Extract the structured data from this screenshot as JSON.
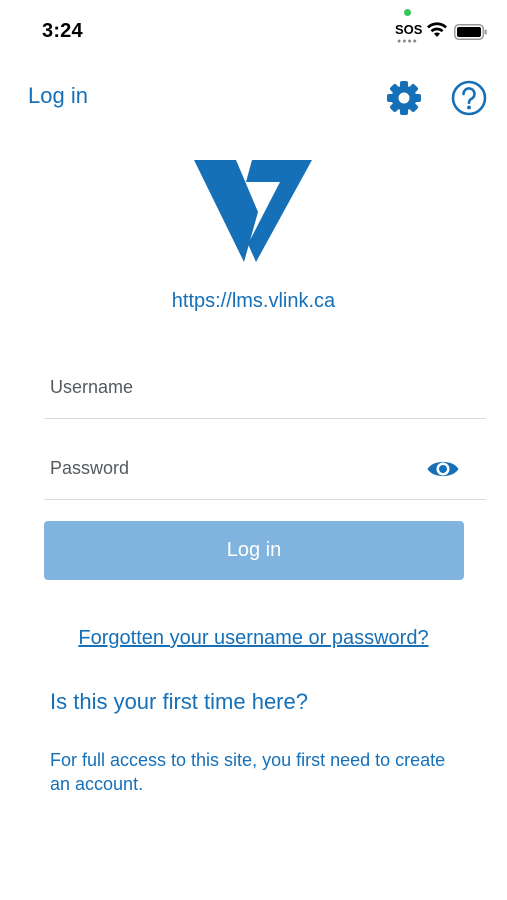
{
  "status_bar": {
    "time": "3:24",
    "sos": "SOS",
    "icons": [
      "wifi-icon",
      "battery-icon"
    ]
  },
  "nav": {
    "title": "Log in",
    "icons": [
      "gear-icon",
      "help-icon"
    ]
  },
  "site": {
    "url": "https://lms.vlink.ca"
  },
  "form": {
    "username_placeholder": "Username",
    "password_placeholder": "Password",
    "login_label": "Log in",
    "forgot_link": "Forgotten your username or password?"
  },
  "signup": {
    "heading": "Is this your first time here?",
    "text": "For full access to this site, you first need to create an account."
  },
  "colors": {
    "accent": "#1670b8",
    "button_disabled": "#80b4de",
    "status_dot": "#34c759"
  }
}
